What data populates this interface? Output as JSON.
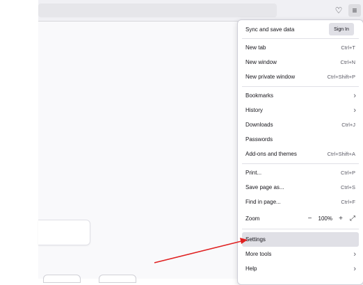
{
  "menu": {
    "sync_label": "Sync and save data",
    "signin_label": "Sign In",
    "items": [
      {
        "label": "New tab",
        "shortcut": "Ctrl+T"
      },
      {
        "label": "New window",
        "shortcut": "Ctrl+N"
      },
      {
        "label": "New private window",
        "shortcut": "Ctrl+Shift+P"
      },
      {
        "label": "Bookmarks",
        "shortcut": ""
      },
      {
        "label": "History",
        "shortcut": ""
      },
      {
        "label": "Downloads",
        "shortcut": "Ctrl+J"
      },
      {
        "label": "Passwords",
        "shortcut": ""
      },
      {
        "label": "Add-ons and themes",
        "shortcut": "Ctrl+Shift+A"
      },
      {
        "label": "Print...",
        "shortcut": "Ctrl+P"
      },
      {
        "label": "Save page as...",
        "shortcut": "Ctrl+S"
      },
      {
        "label": "Find in page...",
        "shortcut": "Ctrl+F"
      },
      {
        "label": "Zoom",
        "shortcut": ""
      },
      {
        "label": "Settings",
        "shortcut": ""
      },
      {
        "label": "More tools",
        "shortcut": ""
      },
      {
        "label": "Help",
        "shortcut": ""
      }
    ],
    "zoom": {
      "level": "100%",
      "minus": "−",
      "plus": "+",
      "fullscreen": "⤢"
    }
  },
  "toolbar": {
    "pocket_icon": "♡",
    "menu_icon": "≡"
  },
  "icons": {
    "chevron": "›"
  },
  "annotation": {
    "arrow_color": "#e02020"
  }
}
